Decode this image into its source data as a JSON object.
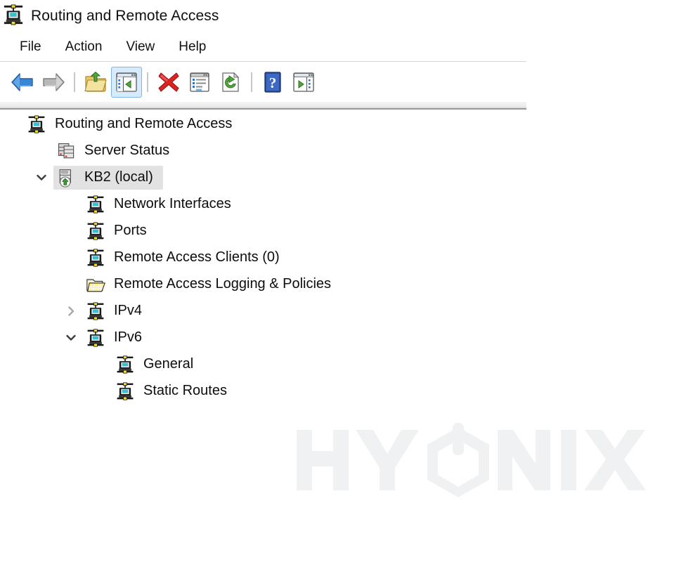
{
  "window": {
    "title": "Routing and Remote Access",
    "icon": "network-computer-icon"
  },
  "menubar": {
    "items": [
      {
        "label": "File",
        "name": "menu-file"
      },
      {
        "label": "Action",
        "name": "menu-action"
      },
      {
        "label": "View",
        "name": "menu-view"
      },
      {
        "label": "Help",
        "name": "menu-help"
      }
    ]
  },
  "toolbar": {
    "buttons": [
      {
        "name": "back-button",
        "icon": "back-arrow-icon",
        "tooltip": "Back",
        "active": false
      },
      {
        "name": "forward-button",
        "icon": "forward-arrow-icon",
        "tooltip": "Forward",
        "active": false
      },
      {
        "name": "separator-1",
        "icon": "separator",
        "tooltip": "",
        "active": false
      },
      {
        "name": "up-one-level-button",
        "icon": "up-folder-icon",
        "tooltip": "Up One Level",
        "active": false
      },
      {
        "name": "show-hide-console-tree-button",
        "icon": "console-tree-icon",
        "tooltip": "Show/Hide Console Tree",
        "active": true
      },
      {
        "name": "separator-2",
        "icon": "separator",
        "tooltip": "",
        "active": false
      },
      {
        "name": "delete-button",
        "icon": "delete-x-icon",
        "tooltip": "Delete",
        "active": false
      },
      {
        "name": "properties-button",
        "icon": "properties-icon",
        "tooltip": "Properties",
        "active": false
      },
      {
        "name": "refresh-button",
        "icon": "refresh-icon",
        "tooltip": "Refresh",
        "active": false
      },
      {
        "name": "separator-3",
        "icon": "separator",
        "tooltip": "",
        "active": false
      },
      {
        "name": "help-button",
        "icon": "help-question-icon",
        "tooltip": "Help",
        "active": false
      },
      {
        "name": "export-list-button",
        "icon": "export-list-icon",
        "tooltip": "Export List",
        "active": false
      }
    ]
  },
  "tree": {
    "nodes": [
      {
        "label": "Routing and Remote Access",
        "name": "tree-node-routing-and-remote-access",
        "icon": "network-computer-icon",
        "indent": 0,
        "twisty": "none",
        "selected": false
      },
      {
        "label": "Server Status",
        "name": "tree-node-server-status",
        "icon": "server-stack-icon",
        "indent": 1,
        "twisty": "none",
        "selected": false
      },
      {
        "label": "KB2 (local)",
        "name": "tree-node-kb2-local",
        "icon": "server-running-icon",
        "indent": 1,
        "twisty": "expanded",
        "selected": true
      },
      {
        "label": "Network Interfaces",
        "name": "tree-node-network-interfaces",
        "icon": "network-computer-icon",
        "indent": 2,
        "twisty": "none",
        "selected": false
      },
      {
        "label": "Ports",
        "name": "tree-node-ports",
        "icon": "network-computer-icon",
        "indent": 2,
        "twisty": "none",
        "selected": false
      },
      {
        "label": "Remote Access Clients (0)",
        "name": "tree-node-remote-access-clients",
        "icon": "network-computer-icon",
        "indent": 2,
        "twisty": "none",
        "selected": false
      },
      {
        "label": "Remote Access Logging & Policies",
        "name": "tree-node-remote-access-logging-and-policies",
        "icon": "open-folder-icon",
        "indent": 2,
        "twisty": "none",
        "selected": false
      },
      {
        "label": "IPv4",
        "name": "tree-node-ipv4",
        "icon": "network-computer-icon",
        "indent": 2,
        "twisty": "collapsed",
        "selected": false
      },
      {
        "label": "IPv6",
        "name": "tree-node-ipv6",
        "icon": "network-computer-icon",
        "indent": 2,
        "twisty": "expanded",
        "selected": false
      },
      {
        "label": "General",
        "name": "tree-node-general",
        "icon": "network-computer-icon",
        "indent": 3,
        "twisty": "none",
        "selected": false
      },
      {
        "label": "Static Routes",
        "name": "tree-node-static-routes",
        "icon": "network-computer-icon",
        "indent": 3,
        "twisty": "none",
        "selected": false
      }
    ]
  },
  "watermark": {
    "text_before": "HY",
    "text_after": "NIX",
    "full_text": "HYONIX",
    "color": "#f0f1f2"
  },
  "colors": {
    "selection": "#e2e2e2",
    "toolbar_active": "#d6ebfb",
    "toolbar_active_border": "#7eb4ea",
    "text": "#0d0d0d",
    "divider": "#d6d6d6"
  }
}
